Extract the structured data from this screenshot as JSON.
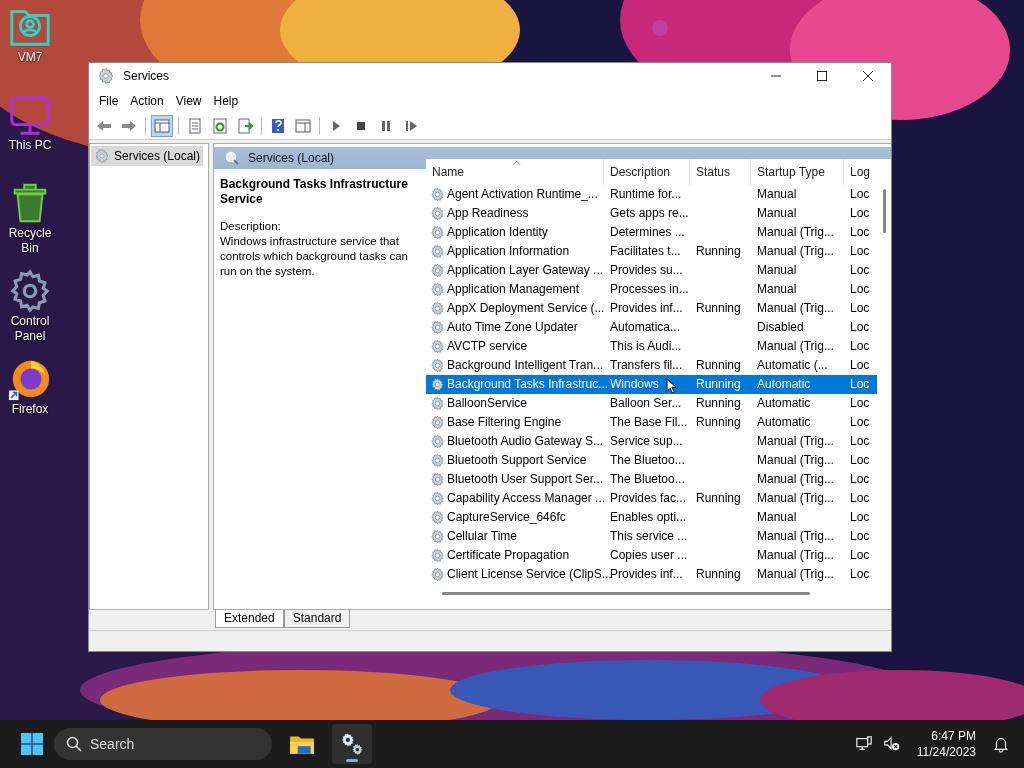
{
  "desktop_icons": [
    {
      "kind": "vm",
      "label": "VM7"
    },
    {
      "kind": "pc",
      "label": "This PC"
    },
    {
      "kind": "bin",
      "label": "Recycle Bin"
    },
    {
      "kind": "control",
      "label": "Control Panel"
    },
    {
      "kind": "firefox",
      "label": "Firefox"
    }
  ],
  "window": {
    "title": "Services",
    "menu": [
      "File",
      "Action",
      "View",
      "Help"
    ],
    "toolbar": [
      {
        "kind": "back",
        "pressed": false
      },
      {
        "kind": "forward",
        "pressed": false
      },
      {
        "kind": "sep"
      },
      {
        "kind": "tree",
        "pressed": true
      },
      {
        "kind": "sep"
      },
      {
        "kind": "properties",
        "pressed": false
      },
      {
        "kind": "refresh",
        "pressed": false
      },
      {
        "kind": "export",
        "pressed": false
      },
      {
        "kind": "sep"
      },
      {
        "kind": "help",
        "pressed": false
      },
      {
        "kind": "pane",
        "pressed": false
      },
      {
        "kind": "sep"
      },
      {
        "kind": "play",
        "pressed": false
      },
      {
        "kind": "stop",
        "pressed": false
      },
      {
        "kind": "pause",
        "pressed": false
      },
      {
        "kind": "resume",
        "pressed": false
      }
    ],
    "tree": [
      {
        "label": "Services (Local)",
        "selected": true
      }
    ],
    "panel_title": "Services (Local)",
    "detail": {
      "title": "Background Tasks Infrastructure Service",
      "description_label": "Description:",
      "description": "Windows infrastructure service that controls which background tasks can run on the system."
    },
    "columns": [
      "Name",
      "Description",
      "Status",
      "Startup Type",
      "Log"
    ],
    "rows": [
      {
        "name": "Agent Activation Runtime_...",
        "description": "Runtime for...",
        "status": "",
        "startup_type": "Manual",
        "log_on": "Loc",
        "selected": false
      },
      {
        "name": "App Readiness",
        "description": "Gets apps re...",
        "status": "",
        "startup_type": "Manual",
        "log_on": "Loc",
        "selected": false
      },
      {
        "name": "Application Identity",
        "description": "Determines ...",
        "status": "",
        "startup_type": "Manual (Trig...",
        "log_on": "Loc",
        "selected": false
      },
      {
        "name": "Application Information",
        "description": "Facilitates t...",
        "status": "Running",
        "startup_type": "Manual (Trig...",
        "log_on": "Loc",
        "selected": false
      },
      {
        "name": "Application Layer Gateway ...",
        "description": "Provides su...",
        "status": "",
        "startup_type": "Manual",
        "log_on": "Loc",
        "selected": false
      },
      {
        "name": "Application Management",
        "description": "Processes in...",
        "status": "",
        "startup_type": "Manual",
        "log_on": "Loc",
        "selected": false
      },
      {
        "name": "AppX Deployment Service (...",
        "description": "Provides inf...",
        "status": "Running",
        "startup_type": "Manual (Trig...",
        "log_on": "Loc",
        "selected": false
      },
      {
        "name": "Auto Time Zone Updater",
        "description": "Automatica...",
        "status": "",
        "startup_type": "Disabled",
        "log_on": "Loc",
        "selected": false
      },
      {
        "name": "AVCTP service",
        "description": "This is Audi...",
        "status": "",
        "startup_type": "Manual (Trig...",
        "log_on": "Loc",
        "selected": false
      },
      {
        "name": "Background Intelligent Tran...",
        "description": "Transfers fil...",
        "status": "Running",
        "startup_type": "Automatic (...",
        "log_on": "Loc",
        "selected": false
      },
      {
        "name": "Background Tasks Infrastruc...",
        "description": "Windows",
        "status": "Running",
        "startup_type": "Automatic",
        "log_on": "Loc",
        "selected": true
      },
      {
        "name": "BalloonService",
        "description": "Balloon Ser...",
        "status": "Running",
        "startup_type": "Automatic",
        "log_on": "Loc",
        "selected": false
      },
      {
        "name": "Base Filtering Engine",
        "description": "The Base Fil...",
        "status": "Running",
        "startup_type": "Automatic",
        "log_on": "Loc",
        "selected": false
      },
      {
        "name": "Bluetooth Audio Gateway S...",
        "description": "Service sup...",
        "status": "",
        "startup_type": "Manual (Trig...",
        "log_on": "Loc",
        "selected": false
      },
      {
        "name": "Bluetooth Support Service",
        "description": "The Bluetoo...",
        "status": "",
        "startup_type": "Manual (Trig...",
        "log_on": "Loc",
        "selected": false
      },
      {
        "name": "Bluetooth User Support Ser...",
        "description": "The Bluetoo...",
        "status": "",
        "startup_type": "Manual (Trig...",
        "log_on": "Loc",
        "selected": false
      },
      {
        "name": "Capability Access Manager ...",
        "description": "Provides fac...",
        "status": "Running",
        "startup_type": "Manual (Trig...",
        "log_on": "Loc",
        "selected": false
      },
      {
        "name": "CaptureService_646fc",
        "description": "Enables opti...",
        "status": "",
        "startup_type": "Manual",
        "log_on": "Loc",
        "selected": false
      },
      {
        "name": "Cellular Time",
        "description": "This service ...",
        "status": "",
        "startup_type": "Manual (Trig...",
        "log_on": "Loc",
        "selected": false
      },
      {
        "name": "Certificate Propagation",
        "description": "Copies user ...",
        "status": "",
        "startup_type": "Manual (Trig...",
        "log_on": "Loc",
        "selected": false
      },
      {
        "name": "Client License Service (ClipS...",
        "description": "Provides inf...",
        "status": "Running",
        "startup_type": "Manual (Trig...",
        "log_on": "Loc",
        "selected": false
      }
    ],
    "tabs": [
      {
        "label": "Extended",
        "selected": true
      },
      {
        "label": "Standard",
        "selected": false
      }
    ]
  },
  "taskbar": {
    "search": {
      "placeholder": "Search"
    },
    "apps": [
      {
        "kind": "explorer",
        "active": false
      },
      {
        "kind": "services",
        "active": true
      }
    ],
    "time": "6:47 PM",
    "date": "11/24/2023"
  }
}
